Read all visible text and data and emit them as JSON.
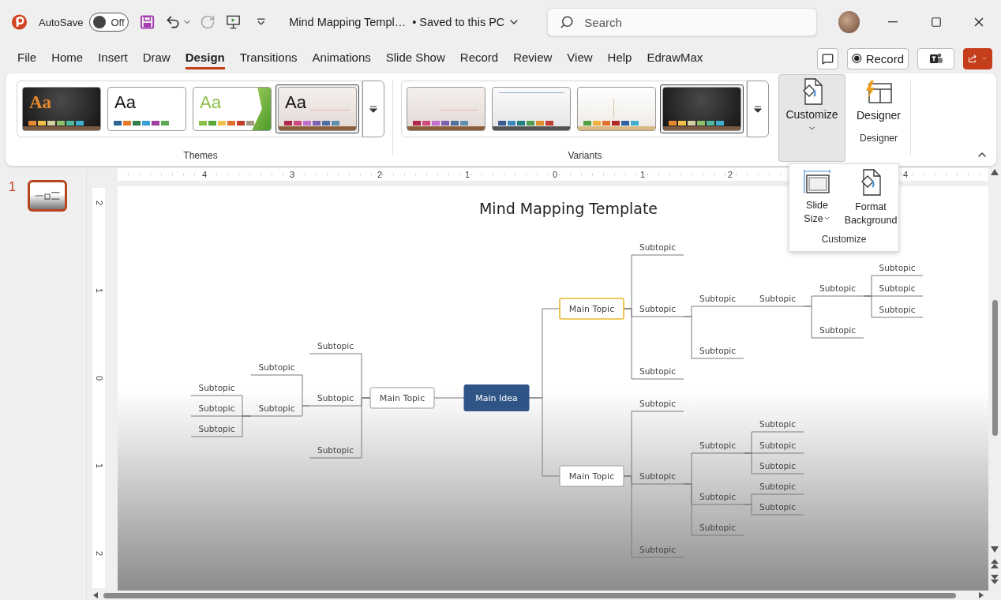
{
  "title_bar": {
    "autosave_label": "AutoSave",
    "autosave_toggle": {
      "label": "Off",
      "on": false
    },
    "redo_disabled": true,
    "document_title": "Mind Mapping Templ…",
    "save_status": "• Saved to this PC",
    "search": {
      "placeholder": "Search"
    }
  },
  "menu_tabs": [
    {
      "label": "File",
      "selected": false
    },
    {
      "label": "Home",
      "selected": false
    },
    {
      "label": "Insert",
      "selected": false
    },
    {
      "label": "Draw",
      "selected": false
    },
    {
      "label": "Design",
      "selected": true
    },
    {
      "label": "Transitions",
      "selected": false
    },
    {
      "label": "Animations",
      "selected": false
    },
    {
      "label": "Slide Show",
      "selected": false
    },
    {
      "label": "Record",
      "selected": false
    },
    {
      "label": "Review",
      "selected": false
    },
    {
      "label": "View",
      "selected": false
    },
    {
      "label": "Help",
      "selected": false
    },
    {
      "label": "EdrawMax",
      "selected": false
    }
  ],
  "record_button": "Record",
  "themes": {
    "label": "Themes",
    "items": [
      {
        "sample": "Aa",
        "kind": "dark",
        "selected": false,
        "swatches": [
          {
            "color": "#e8892f"
          },
          {
            "color": "#f0c048"
          },
          {
            "color": "#d6cfa0"
          },
          {
            "color": "#8fbf6a"
          },
          {
            "color": "#4fb89a"
          },
          {
            "color": "#3fb0d0"
          }
        ]
      },
      {
        "sample": "Aa",
        "kind": "white",
        "selected": false,
        "swatches": [
          {
            "color": "#2e6496"
          },
          {
            "color": "#e57a2c"
          },
          {
            "color": "#2e7d4a"
          },
          {
            "color": "#3aa0d8"
          },
          {
            "color": "#a040a0"
          },
          {
            "color": "#5aa850"
          }
        ]
      },
      {
        "sample": "Aa",
        "kind": "green",
        "selected": false,
        "swatches": [
          {
            "color": "#8cc04a"
          },
          {
            "color": "#5aa83a"
          },
          {
            "color": "#f0c050"
          },
          {
            "color": "#e07030"
          },
          {
            "color": "#c04028"
          },
          {
            "color": "#a09880"
          }
        ]
      },
      {
        "sample": "Aa",
        "kind": "beige",
        "selected": true,
        "swatches": [
          {
            "color": "#b02848"
          },
          {
            "color": "#d04880"
          },
          {
            "color": "#c070d0"
          },
          {
            "color": "#8060b0"
          },
          {
            "color": "#5070a0"
          },
          {
            "color": "#6090b0"
          }
        ]
      }
    ]
  },
  "variants": {
    "label": "Variants",
    "items": [
      {
        "kind": "beige",
        "selected": false,
        "swatches": [
          {
            "color": "#b02848"
          },
          {
            "color": "#d04880"
          },
          {
            "color": "#c070d0"
          },
          {
            "color": "#8060b0"
          },
          {
            "color": "#5070a0"
          },
          {
            "color": "#6090b0"
          }
        ]
      },
      {
        "kind": "grey",
        "selected": false,
        "swatches": [
          {
            "color": "#3a5a90"
          },
          {
            "color": "#3a8ac0"
          },
          {
            "color": "#208080"
          },
          {
            "color": "#50a050"
          },
          {
            "color": "#e09030"
          },
          {
            "color": "#c04030"
          }
        ]
      },
      {
        "kind": "gold",
        "selected": false,
        "swatches": [
          {
            "color": "#50a040"
          },
          {
            "color": "#f0b040"
          },
          {
            "color": "#e07030"
          },
          {
            "color": "#b02828"
          },
          {
            "color": "#3060a0"
          },
          {
            "color": "#40b0d0"
          }
        ]
      },
      {
        "kind": "dark",
        "selected": true,
        "swatches": [
          {
            "color": "#e8892f"
          },
          {
            "color": "#f0c048"
          },
          {
            "color": "#d6cfa0"
          },
          {
            "color": "#8fbf6a"
          },
          {
            "color": "#4fb89a"
          },
          {
            "color": "#3fb0d0"
          }
        ]
      }
    ]
  },
  "customize": {
    "label": "Customize",
    "expanded": true
  },
  "designer": {
    "button": "Designer",
    "group_label": "Designer"
  },
  "customize_menu": {
    "items": [
      {
        "label": "Slide Size",
        "kind": "slide-size"
      },
      {
        "label": "Format Background",
        "kind": "format-background"
      }
    ],
    "group_label": "Customize"
  },
  "slides": [
    {
      "number": "1",
      "selected": true
    }
  ],
  "horizontal_ruler": [
    "4",
    "3",
    "2",
    "1",
    "0",
    "1",
    "2",
    "4"
  ],
  "vertical_ruler": [
    "2",
    "1",
    "0",
    "1",
    "2"
  ],
  "slide": {
    "title": "Mind Mapping Template",
    "mind_map": {
      "label": "Main Idea",
      "kind": "idea",
      "selected": false,
      "children": [
        {
          "label": "Main Topic",
          "kind": "topic",
          "selected": false,
          "children": [
            {
              "label": "Subtopic",
              "kind": "subtopic",
              "selected": false
            },
            {
              "label": "Subtopic",
              "kind": "subtopic",
              "selected": false,
              "children": [
                {
                  "label": "Subtopic",
                  "kind": "subtopic",
                  "selected": false
                },
                {
                  "label": "Subtopic",
                  "kind": "subtopic",
                  "selected": false,
                  "children": [
                    {
                      "label": "Subtopic",
                      "kind": "subtopic",
                      "selected": false
                    },
                    {
                      "label": "Subtopic",
                      "kind": "subtopic",
                      "selected": false
                    },
                    {
                      "label": "Subtopic",
                      "kind": "subtopic",
                      "selected": false
                    }
                  ]
                }
              ]
            },
            {
              "label": "Subtopic",
              "kind": "subtopic",
              "selected": false
            }
          ]
        },
        {
          "label": "Main Topic",
          "kind": "topic",
          "selected": true,
          "children": [
            {
              "label": "Subtopic",
              "kind": "subtopic",
              "selected": false
            },
            {
              "label": "Subtopic",
              "kind": "subtopic",
              "selected": false,
              "children": [
                {
                  "label": "Subtopic",
                  "kind": "subtopic",
                  "selected": false,
                  "children": [
                    {
                      "label": "Subtopic",
                      "kind": "subtopic",
                      "selected": false,
                      "children": [
                        {
                          "label": "Subtopic",
                          "kind": "subtopic",
                          "selected": false,
                          "children": [
                            {
                              "label": "Subtopic",
                              "kind": "subtopic",
                              "selected": false
                            },
                            {
                              "label": "Subtopic",
                              "kind": "subtopic",
                              "selected": false
                            },
                            {
                              "label": "Subtopic",
                              "kind": "subtopic",
                              "selected": false
                            }
                          ]
                        },
                        {
                          "label": "Subtopic",
                          "kind": "subtopic",
                          "selected": false
                        }
                      ]
                    }
                  ]
                },
                {
                  "label": "Subtopic",
                  "kind": "subtopic",
                  "selected": false
                }
              ]
            },
            {
              "label": "Subtopic",
              "kind": "subtopic",
              "selected": false
            }
          ]
        },
        {
          "label": "Main Topic",
          "kind": "topic",
          "selected": false,
          "children": [
            {
              "label": "Subtopic",
              "kind": "subtopic",
              "selected": false
            },
            {
              "label": "Subtopic",
              "kind": "subtopic",
              "selected": false,
              "children": [
                {
                  "label": "Subtopic",
                  "kind": "subtopic",
                  "selected": false,
                  "children": [
                    {
                      "label": "Subtopic",
                      "kind": "subtopic",
                      "selected": false
                    },
                    {
                      "label": "Subtopic",
                      "kind": "subtopic",
                      "selected": false
                    },
                    {
                      "label": "Subtopic",
                      "kind": "subtopic",
                      "selected": false
                    }
                  ]
                },
                {
                  "label": "Subtopic",
                  "kind": "subtopic",
                  "selected": false,
                  "children": [
                    {
                      "label": "Subtopic",
                      "kind": "subtopic",
                      "selected": false
                    },
                    {
                      "label": "Subtopic",
                      "kind": "subtopic",
                      "selected": false
                    }
                  ]
                },
                {
                  "label": "Subtopic",
                  "kind": "subtopic",
                  "selected": false
                }
              ]
            },
            {
              "label": "Subtopic",
              "kind": "subtopic",
              "selected": false
            }
          ]
        }
      ]
    }
  }
}
